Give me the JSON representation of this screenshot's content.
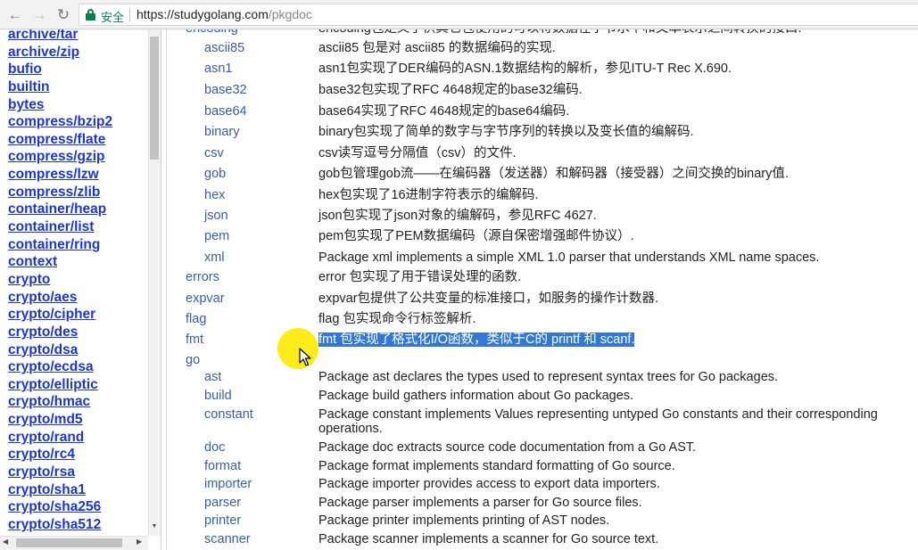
{
  "browser": {
    "secure_label": "安全",
    "url_host": "https://studygolang.com",
    "url_path": "/pkgdoc",
    "icons": [
      "back-icon",
      "forward-icon",
      "reload-icon",
      "lock-icon"
    ]
  },
  "sidebar": {
    "packages": [
      "archive/tar",
      "archive/zip",
      "bufio",
      "builtin",
      "bytes",
      "compress/bzip2",
      "compress/flate",
      "compress/gzip",
      "compress/lzw",
      "compress/zlib",
      "container/heap",
      "container/list",
      "container/ring",
      "context",
      "crypto",
      "crypto/aes",
      "crypto/cipher",
      "crypto/des",
      "crypto/dsa",
      "crypto/ecdsa",
      "crypto/elliptic",
      "crypto/hmac",
      "crypto/md5",
      "crypto/rand",
      "crypto/rc4",
      "crypto/rsa",
      "crypto/sha1",
      "crypto/sha256",
      "crypto/sha512"
    ]
  },
  "content": {
    "rows": [
      {
        "name": "encoding",
        "desc": "encoding包定义了供其它包使用的可以将数据在字节水平和文本表示之间转换的接口."
      },
      {
        "name": "ascii85",
        "desc": "ascii85 包是对 ascii85 的数据编码的实现."
      },
      {
        "name": "asn1",
        "desc": "asn1包实现了DER编码的ASN.1数据结构的解析，参见ITU-T Rec X.690."
      },
      {
        "name": "base32",
        "desc": "base32包实现了RFC 4648规定的base32编码."
      },
      {
        "name": "base64",
        "desc": "base64实现了RFC 4648规定的base64编码."
      },
      {
        "name": "binary",
        "desc": "binary包实现了简单的数字与字节序列的转换以及变长值的编解码."
      },
      {
        "name": "csv",
        "desc": "csv读写逗号分隔值（csv）的文件."
      },
      {
        "name": "gob",
        "desc": "gob包管理gob流——在编码器（发送器）和解码器（接受器）之间交换的binary值."
      },
      {
        "name": "hex",
        "desc": "hex包实现了16进制字符表示的编解码."
      },
      {
        "name": "json",
        "desc": "json包实现了json对象的编解码，参见RFC 4627."
      },
      {
        "name": "pem",
        "desc": "pem包实现了PEM数据编码（源自保密增强邮件协议）."
      },
      {
        "name": "xml",
        "desc": "Package xml implements a simple XML 1.0 parser that understands XML name spaces."
      },
      {
        "name": "errors",
        "desc": "error 包实现了用于错误处理的函数."
      },
      {
        "name": "expvar",
        "desc": "expvar包提供了公共变量的标准接口，如服务的操作计数器."
      },
      {
        "name": "flag",
        "desc": "flag 包实现命令行标签解析."
      },
      {
        "name": "fmt",
        "desc": "fmt 包实现了格式化I/O函数，类似于C的 printf 和 scanf."
      },
      {
        "name": "go",
        "desc": ""
      },
      {
        "name": "ast",
        "desc": "Package ast declares the types used to represent syntax trees for Go packages."
      },
      {
        "name": "build",
        "desc": "Package build gathers information about Go packages."
      },
      {
        "name": "constant",
        "desc": "Package constant implements Values representing untyped Go constants and their corresponding operations."
      },
      {
        "name": "doc",
        "desc": "Package doc extracts source code documentation from a Go AST."
      },
      {
        "name": "format",
        "desc": "Package format implements standard formatting of Go source."
      },
      {
        "name": "importer",
        "desc": "Package importer provides access to export data importers."
      },
      {
        "name": "parser",
        "desc": "Package parser implements a parser for Go source files."
      },
      {
        "name": "printer",
        "desc": "Package printer implements printing of AST nodes."
      },
      {
        "name": "scanner",
        "desc": "Package scanner implements a scanner for Go source text."
      }
    ]
  },
  "colors": {
    "link": "#1c37c9",
    "pkg_name": "#375eab",
    "selection": "#3478d6",
    "cursor_highlight": "#fdeb1a",
    "secure_green": "#0b8043"
  }
}
